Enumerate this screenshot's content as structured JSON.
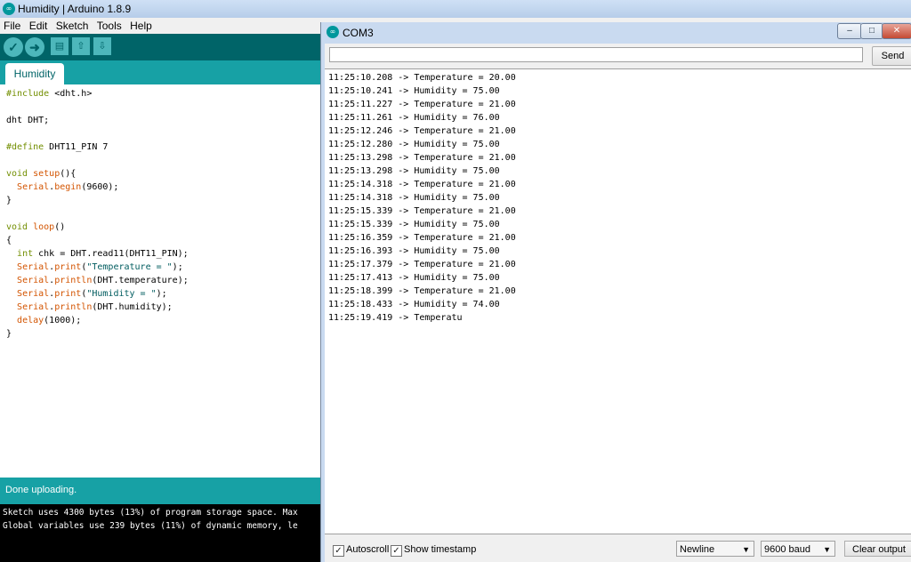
{
  "ide": {
    "window_title": "Humidity | Arduino 1.8.9",
    "menu": [
      "File",
      "Edit",
      "Sketch",
      "Tools",
      "Help"
    ],
    "tab_label": "Humidity",
    "code": [
      "#include <dht.h>",
      "",
      "dht DHT;",
      "",
      "#define DHT11_PIN 7",
      "",
      "void setup(){",
      "  Serial.begin(9600);",
      "}",
      "",
      "void loop()",
      "{",
      "  int chk = DHT.read11(DHT11_PIN);",
      "  Serial.print(\"Temperature = \");",
      "  Serial.println(DHT.temperature);",
      "  Serial.print(\"Humidity = \");",
      "  Serial.println(DHT.humidity);",
      "  delay(1000);",
      "}"
    ],
    "status": "Done uploading.",
    "console": [
      "Sketch uses 4300 bytes (13%) of program storage space. Max",
      "Global variables use 239 bytes (11%) of dynamic memory, le"
    ],
    "colors": {
      "toolbar": "#006468",
      "tabbar": "#17a1a5",
      "console": "#000000"
    }
  },
  "serial": {
    "title": "COM3",
    "send_label": "Send",
    "input_value": "",
    "lines": [
      "11:25:10.208 -> Temperature = 20.00",
      "11:25:10.241 -> Humidity = 75.00",
      "11:25:11.227 -> Temperature = 21.00",
      "11:25:11.261 -> Humidity = 76.00",
      "11:25:12.246 -> Temperature = 21.00",
      "11:25:12.280 -> Humidity = 75.00",
      "11:25:13.298 -> Temperature = 21.00",
      "11:25:13.298 -> Humidity = 75.00",
      "11:25:14.318 -> Temperature = 21.00",
      "11:25:14.318 -> Humidity = 75.00",
      "11:25:15.339 -> Temperature = 21.00",
      "11:25:15.339 -> Humidity = 75.00",
      "11:25:16.359 -> Temperature = 21.00",
      "11:25:16.393 -> Humidity = 75.00",
      "11:25:17.379 -> Temperature = 21.00",
      "11:25:17.413 -> Humidity = 75.00",
      "11:25:18.399 -> Temperature = 21.00",
      "11:25:18.433 -> Humidity = 74.00",
      "11:25:19.419 -> Temperatu"
    ],
    "autoscroll_label": "Autoscroll",
    "autoscroll_checked": true,
    "timestamp_label": "Show timestamp",
    "timestamp_checked": true,
    "line_ending": "Newline",
    "baud": "9600 baud",
    "clear_label": "Clear output"
  }
}
